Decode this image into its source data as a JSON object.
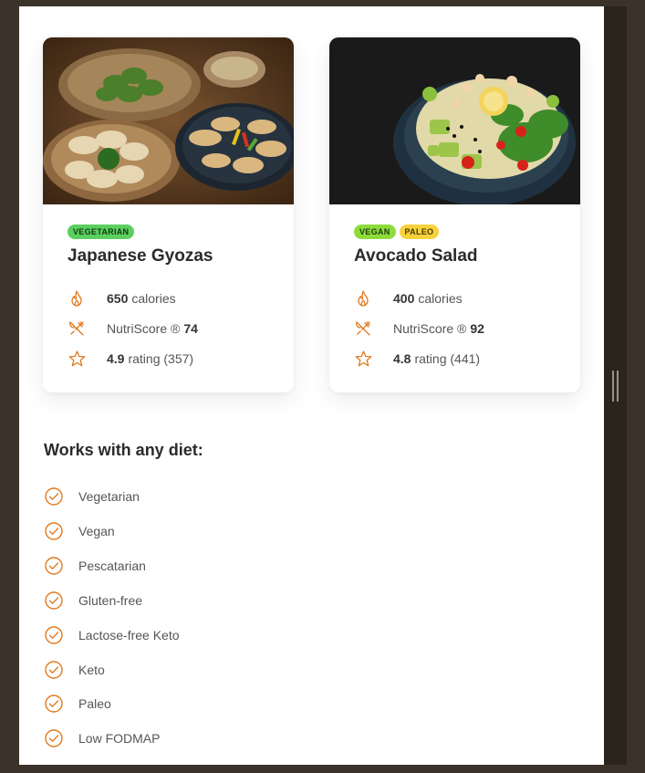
{
  "colors": {
    "accent": "#e07a1f",
    "background": "#3b3229",
    "panel": "#ffffff"
  },
  "cards": [
    {
      "image": "gyoza-dumplings-photo",
      "tags": [
        {
          "label": "VEGETARIAN",
          "color": "#5bcf5f"
        }
      ],
      "title": "Japanese Gyozas",
      "calories_value": "650",
      "calories_label": "calories",
      "nutri_label": "NutriScore ®",
      "nutri_value": "74",
      "rating_value": "4.9",
      "rating_label": "rating (357)"
    },
    {
      "image": "avocado-salad-bowl-photo",
      "tags": [
        {
          "label": "VEGAN",
          "color": "#8edb3c"
        },
        {
          "label": "PALEO",
          "color": "#f7d23b"
        }
      ],
      "title": "Avocado Salad",
      "calories_value": "400",
      "calories_label": "calories",
      "nutri_label": "NutriScore ®",
      "nutri_value": "92",
      "rating_value": "4.8",
      "rating_label": "rating (441)"
    }
  ],
  "icons": {
    "calories": "flame-icon",
    "nutri": "fork-knife-icon",
    "rating": "star-icon",
    "diet": "check-circle-icon"
  },
  "diet": {
    "title": "Works with any diet:",
    "items": [
      "Vegetarian",
      "Vegan",
      "Pescatarian",
      "Gluten-free",
      "Lactose-free Keto",
      "Keto",
      "Paleo",
      "Low FODMAP"
    ]
  }
}
